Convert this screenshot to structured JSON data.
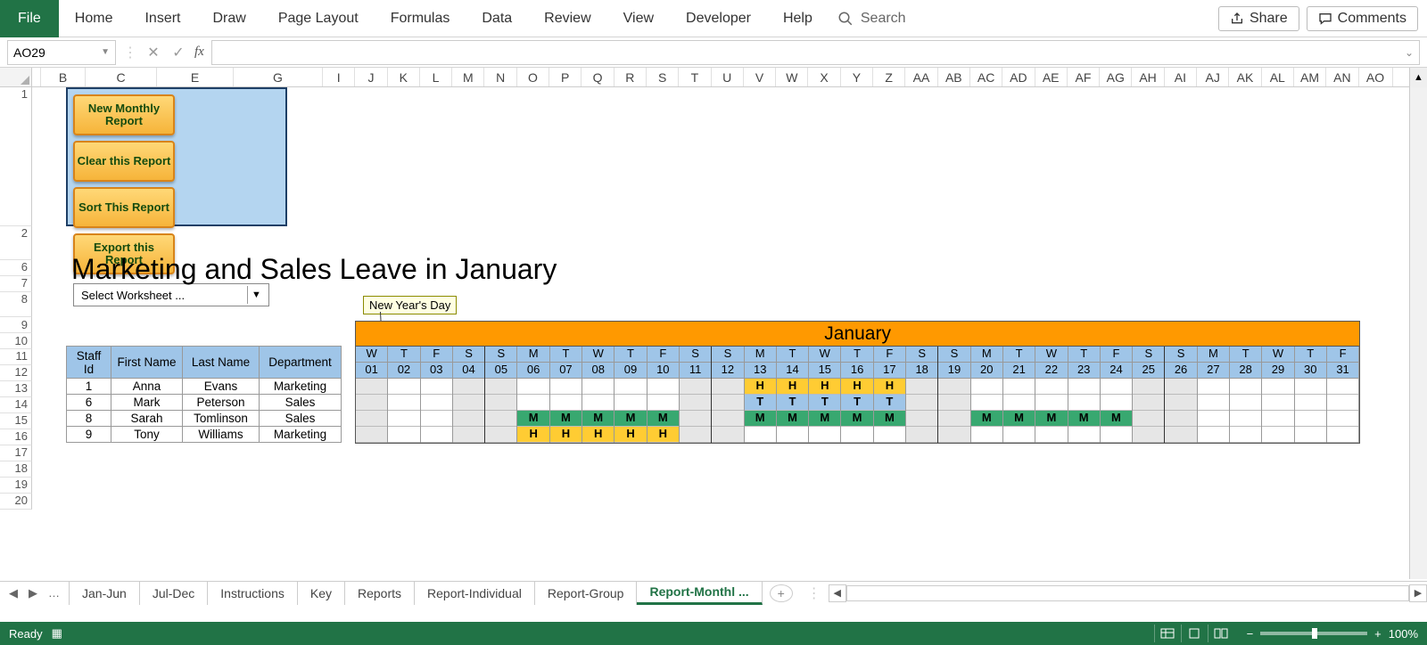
{
  "ribbon": {
    "file": "File",
    "tabs": [
      "Home",
      "Insert",
      "Draw",
      "Page Layout",
      "Formulas",
      "Data",
      "Review",
      "View",
      "Developer",
      "Help"
    ],
    "search": "Search",
    "share": "Share",
    "comments": "Comments"
  },
  "fbar": {
    "namebox": "AO29"
  },
  "macro": {
    "b1": "New Monthly Report",
    "b2": "Clear this Report",
    "b3": "Sort This Report",
    "b4": "Export this Report",
    "select": "Select Worksheet ..."
  },
  "title": "Marketing and Sales Leave in January",
  "tooltip": "New Year's Day",
  "cols_main": [
    "B",
    "C",
    "E",
    "G"
  ],
  "cols_days": [
    "I",
    "J",
    "K",
    "L",
    "M",
    "N",
    "O",
    "P",
    "Q",
    "R",
    "S",
    "T",
    "U",
    "V",
    "W",
    "X",
    "Y",
    "Z",
    "AA",
    "AB",
    "AC",
    "AD",
    "AE",
    "AF",
    "AG",
    "AH",
    "AI",
    "AJ",
    "AK",
    "AL",
    "AM",
    "AN"
  ],
  "col_last": "AO",
  "rownums": [
    "1",
    "2",
    "6",
    "7",
    "8",
    "9",
    "10",
    "11",
    "12",
    "13",
    "14",
    "15",
    "16",
    "17",
    "18",
    "19",
    "20"
  ],
  "staff": {
    "head": [
      "Staff Id",
      "First Name",
      "Last Name",
      "Department"
    ],
    "rows": [
      [
        "1",
        "Anna",
        "Evans",
        "Marketing"
      ],
      [
        "6",
        "Mark",
        "Peterson",
        "Sales"
      ],
      [
        "8",
        "Sarah",
        "Tomlinson",
        "Sales"
      ],
      [
        "9",
        "Tony",
        "Williams",
        "Marketing"
      ]
    ]
  },
  "cal": {
    "month": "January",
    "dow": [
      "W",
      "T",
      "F",
      "S",
      "S",
      "M",
      "T",
      "W",
      "T",
      "F",
      "S",
      "S",
      "M",
      "T",
      "W",
      "T",
      "F",
      "S",
      "S",
      "M",
      "T",
      "W",
      "T",
      "F",
      "S",
      "S",
      "M",
      "T",
      "W",
      "T",
      "F"
    ],
    "num": [
      "01",
      "02",
      "03",
      "04",
      "05",
      "06",
      "07",
      "08",
      "09",
      "10",
      "11",
      "12",
      "13",
      "14",
      "15",
      "16",
      "17",
      "18",
      "19",
      "20",
      "21",
      "22",
      "23",
      "24",
      "25",
      "26",
      "27",
      "28",
      "29",
      "30",
      "31"
    ],
    "week_sep": [
      3,
      10,
      17,
      24
    ],
    "rows": [
      {
        "cells": {
          "12": "H",
          "13": "H",
          "14": "H",
          "15": "H",
          "16": "H"
        },
        "cls": "bH"
      },
      {
        "cells": {
          "12": "T",
          "13": "T",
          "14": "T",
          "15": "T",
          "16": "T"
        },
        "cls": "bT"
      },
      {
        "cells": {
          "5": "M",
          "6": "M",
          "7": "M",
          "8": "M",
          "9": "M",
          "12": "M",
          "13": "M",
          "14": "M",
          "15": "M",
          "16": "M",
          "19": "M",
          "20": "M",
          "21": "M",
          "22": "M",
          "23": "M"
        },
        "cls": "bM"
      },
      {
        "cells": {
          "5": "H",
          "6": "H",
          "7": "H",
          "8": "H",
          "9": "H"
        },
        "cls": "bH"
      }
    ]
  },
  "sheettabs": [
    "Jan-Jun",
    "Jul-Dec",
    "Instructions",
    "Key",
    "Reports",
    "Report-Individual",
    "Report-Group"
  ],
  "sheettab_active": "Report-Monthl ...",
  "status": {
    "ready": "Ready",
    "zoom": "100%"
  }
}
